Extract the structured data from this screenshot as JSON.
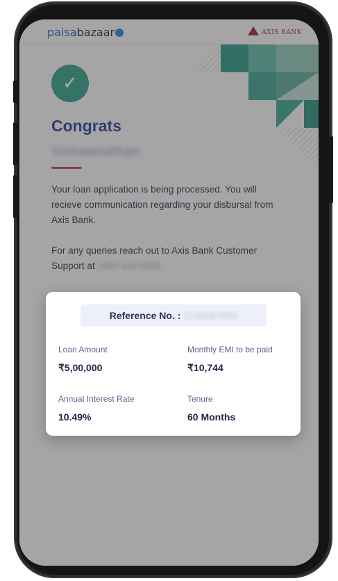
{
  "header": {
    "brand_left_a": "paisa",
    "brand_left_b": "bazaar",
    "brand_right": "AXIS BANK"
  },
  "confirmation": {
    "heading": "Congrats",
    "name": "Vishwanathan",
    "message": "Your loan application is being processed. You will recieve communication regarding your disbursal from Axis Bank.",
    "support_text": "For any queries reach out to Axis Bank Customer Support at",
    "support_phone": "1860 419 5555"
  },
  "card": {
    "reference_label": "Reference No. :",
    "reference_value": "1234567890",
    "loan_amount_label": "Loan Amount",
    "loan_amount_value": "₹5,00,000",
    "emi_label": "Monthly EMI to be paid",
    "emi_value": "₹10,744",
    "interest_label": "Annual Interest Rate",
    "interest_value": "10.49%",
    "tenure_label": "Tenure",
    "tenure_value": "60 Months"
  },
  "colors": {
    "brand_blue": "#2d3f9a",
    "success_green": "#2f9c84",
    "accent_red": "#c23b5c",
    "axis_maroon": "#a51c40"
  }
}
